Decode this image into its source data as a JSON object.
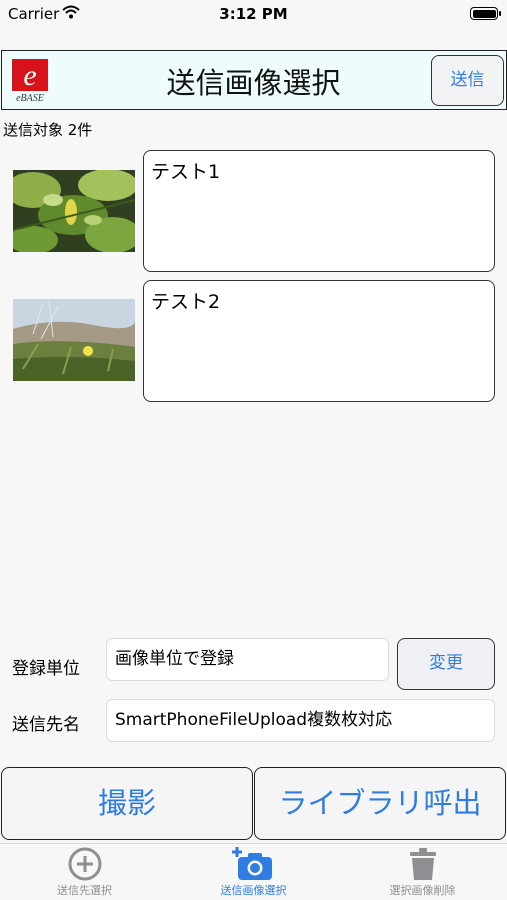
{
  "status_bar": {
    "carrier": "Carrier",
    "time": "3:12 PM"
  },
  "header": {
    "title": "送信画像選択",
    "send_label": "送信",
    "logo_text": "eBASE"
  },
  "target_count": "送信対象 2件",
  "images": [
    {
      "comment": "テスト1"
    },
    {
      "comment": "テスト2"
    }
  ],
  "form": {
    "unit_label": "登録単位",
    "unit_value": "画像単位で登録",
    "change_label": "変更",
    "destination_label": "送信先名",
    "destination_value": "SmartPhoneFileUpload複数枚対応"
  },
  "actions": {
    "camera_label": "撮影",
    "library_label": "ライブラリ呼出"
  },
  "tab_bar": {
    "items": [
      {
        "label": "送信先選択",
        "icon": "plus-circle-icon",
        "active": false
      },
      {
        "label": "送信画像選択",
        "icon": "camera-plus-icon",
        "active": true
      },
      {
        "label": "選択画像削除",
        "icon": "trash-icon",
        "active": false
      }
    ]
  },
  "colors": {
    "accent": "#2f7de1",
    "inactive": "#8e8e93",
    "header_bg": "#eefcfd"
  }
}
